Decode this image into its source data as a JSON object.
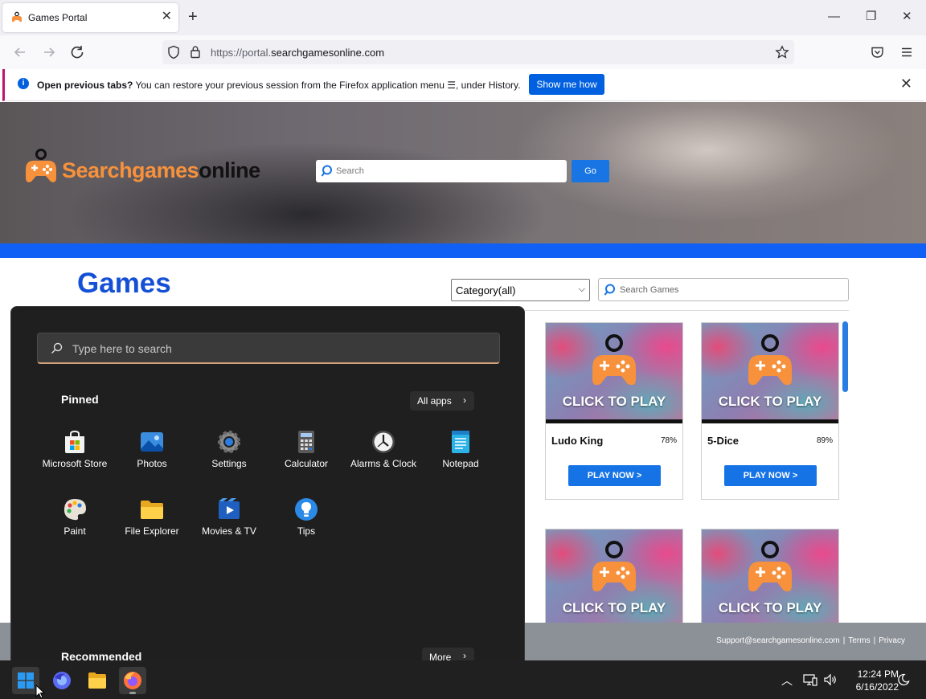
{
  "browser": {
    "tab_title": "Games Portal",
    "url_prefix": "https://portal.",
    "url_domain": "searchgamesonline.com",
    "infobar": {
      "bold_text": "Open previous tabs?",
      "text_before_icon": "You can restore your previous session from the Firefox application menu",
      "text_after_icon": ", under History.",
      "button_label": "Show me how"
    }
  },
  "site": {
    "logo_orange": "Searchgames",
    "logo_dark": "online",
    "hero_search_placeholder": "Search",
    "hero_go_label": "Go",
    "games_heading": "Games",
    "category_selected": "Category(all)",
    "games_search_placeholder": "Search Games",
    "games": [
      {
        "name": "Ludo King",
        "rating": "78%",
        "cta": "CLICK TO PLAY",
        "button": "PLAY NOW >"
      },
      {
        "name": "5-Dice",
        "rating": "89%",
        "cta": "CLICK TO PLAY",
        "button": "PLAY NOW >"
      },
      {
        "cta": "CLICK TO PLAY"
      },
      {
        "cta": "CLICK TO PLAY"
      }
    ],
    "footer": {
      "support": "Support@searchgamesonline.com",
      "separator": "|",
      "terms": "Terms",
      "privacy": "Privacy"
    }
  },
  "start_menu": {
    "search_placeholder": "Type here to search",
    "pinned_label": "Pinned",
    "all_apps_label": "All apps",
    "apps": [
      {
        "label": "Microsoft Store",
        "icon": "store-icon"
      },
      {
        "label": "Photos",
        "icon": "photos-icon"
      },
      {
        "label": "Settings",
        "icon": "settings-icon"
      },
      {
        "label": "Calculator",
        "icon": "calculator-icon"
      },
      {
        "label": "Alarms & Clock",
        "icon": "clock-icon"
      },
      {
        "label": "Notepad",
        "icon": "notepad-icon"
      },
      {
        "label": "Paint",
        "icon": "paint-icon"
      },
      {
        "label": "File Explorer",
        "icon": "folder-icon"
      },
      {
        "label": "Movies & TV",
        "icon": "movies-icon"
      },
      {
        "label": "Tips",
        "icon": "tips-icon"
      }
    ],
    "recommended_label": "Recommended",
    "more_label": "More"
  },
  "taskbar": {
    "time": "12:24 PM",
    "date": "6/16/2022"
  },
  "colors": {
    "brand_orange": "#f7913c",
    "site_blue": "#1060f5",
    "firefox_blue": "#0060df"
  }
}
